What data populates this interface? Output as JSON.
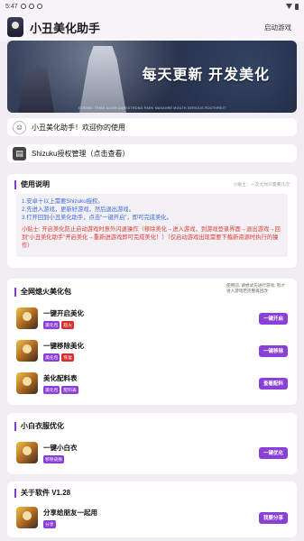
{
  "status": {
    "time": "5:47"
  },
  "appbar": {
    "title": "小丑美化助手",
    "launch_label": "启动游戏"
  },
  "banner": {
    "headline": "每天更新 开发美化",
    "small_text": "STRONG TRIBE DOOM DARKSTRONG PARK MASAHRE MOUTH SERIOUS ROOTHREIT"
  },
  "welcome": {
    "text": "小丑美化助手！欢迎你的使用"
  },
  "shizuku": {
    "text": "Shizuku授权管理（点击查看）"
  },
  "usage": {
    "title": "使用说明",
    "hint": "小贴士：一次尤你只需要几次",
    "steps": [
      "1.安卓十以上需要Shizuku授权。",
      "2.先进入游戏，更新好游戏，然后退出游戏。",
      "3.打开回到小丑美化助手，点击“一键开启”，即可完成美化。"
    ],
    "tip": "小贴士: 开启美化防止启动游戏时意外闪退操作（移除美化→进入游戏，到游戏登录界面→退出游戏→回到“小丑美化助手”开启美化→重新进游戏即可完成美化！）（仅启动游戏出现需要下载新资源时执行的操作）"
  },
  "package": {
    "title": "全网熄火美化包",
    "note": "使用前, 请尝试先进行游戏, 有才进入游戏若完整再回改",
    "items": [
      {
        "name": "一键开启美化",
        "tags": [
          {
            "text": "美化包",
            "color": "purple"
          },
          {
            "text": "超火",
            "color": "red"
          }
        ],
        "button": "一键开启"
      },
      {
        "name": "一键移除美化",
        "tags": [
          {
            "text": "美化包",
            "color": "purple"
          },
          {
            "text": "恢复",
            "color": "red"
          }
        ],
        "button": "一键移除"
      },
      {
        "name": "美化配料表",
        "tags": [
          {
            "text": "美化包",
            "color": "purple"
          },
          {
            "text": "配料表",
            "color": "purple"
          }
        ],
        "button": "查看配料"
      }
    ]
  },
  "whiteclothes": {
    "title": "小白衣服优化",
    "items": [
      {
        "name": "一键小白衣",
        "tags": [
          {
            "text": "移除皮肤",
            "color": "purple"
          }
        ],
        "button": "一键优化"
      }
    ]
  },
  "about": {
    "title": "关于软件 V1.28",
    "items": [
      {
        "name": "分享给朋友一起用",
        "tags": [
          {
            "text": "分享",
            "color": "purple"
          }
        ],
        "button": "我要分享"
      }
    ]
  },
  "colors": {
    "accent": "#8a3fd6",
    "link_blue": "#3a6bd8",
    "warn_red": "#e0392f",
    "background": "#f1eef3"
  },
  "icons": {
    "welcome": "smiley-icon",
    "shizuku": "document-icon"
  }
}
